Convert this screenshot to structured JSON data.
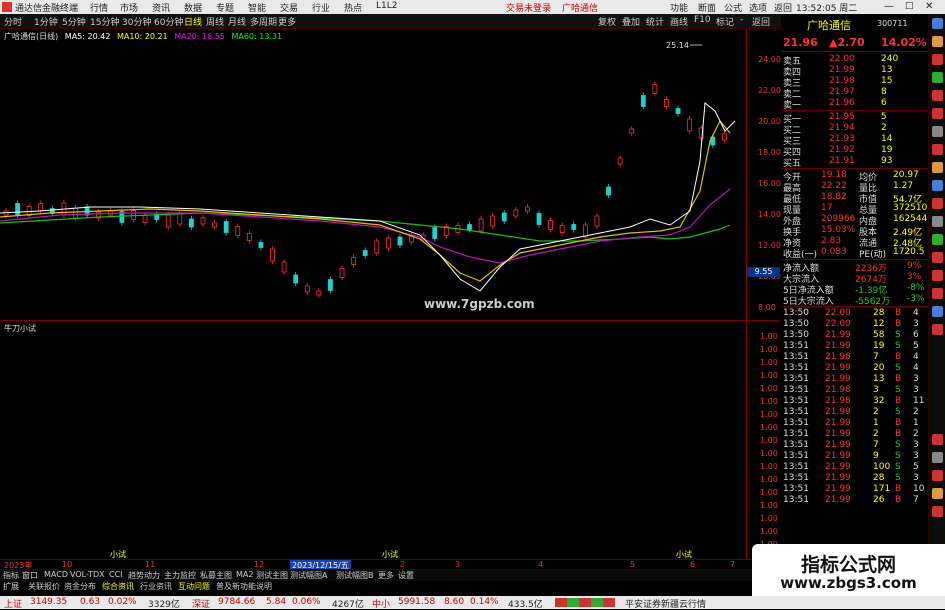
{
  "titlebar": {
    "app_title": "通达信金融终端",
    "menus": [
      "行情",
      "市场",
      "资讯",
      "数据",
      "专题",
      "智能",
      "交易",
      "行业",
      "热点",
      "L1L2"
    ],
    "center": [
      "交易未登录",
      "广哈通信"
    ],
    "right": [
      "功能",
      "断面",
      "公式",
      "选项",
      "返回"
    ],
    "clock": "13:52:05 周二"
  },
  "menubar": {
    "periods": [
      "分时",
      "1分钟",
      "5分钟",
      "15分钟",
      "30分钟",
      "60分钟",
      "日线",
      "周线",
      "月线",
      "多周期",
      "更多"
    ],
    "active": "日线",
    "right": [
      "复权",
      "叠加",
      "统计",
      "画线",
      "F10",
      "标记",
      "-",
      "返回"
    ]
  },
  "main_chart": {
    "legend_name": "广哈通信(日线)",
    "ma": [
      {
        "label": "MA5: 20.42",
        "color": "#ffffff"
      },
      {
        "label": "MA10: 20.21",
        "color": "#ffff00"
      },
      {
        "label": "MA20: 16.55",
        "color": "#ff00ff"
      },
      {
        "label": "MA60: 13.31",
        "color": "#00ff00"
      }
    ],
    "high_label": "25.14",
    "left_price": "9.55",
    "watermark": "www.7gpzb.com",
    "yticks": [
      "24.00",
      "22.00",
      "20.00",
      "18.00",
      "16.00",
      "14.00",
      "12.00",
      "10.00",
      "8.00"
    ]
  },
  "sub_chart": {
    "name": "牛刀小试",
    "yticks": [
      "1.00",
      "1.00",
      "1.00",
      "1.00",
      "1.00",
      "1.00",
      "1.00",
      "1.00",
      "1.00",
      "1.00",
      "1.00",
      "1.00",
      "1.00",
      "1.00",
      "1.00",
      "1.00",
      "1.00"
    ],
    "signals": [
      "小试",
      "小试",
      "小试"
    ]
  },
  "axis_bar": {
    "labels": [
      "2023年",
      "10",
      "11",
      "12",
      "2023/12/15/五",
      "2",
      "3",
      "4",
      "5",
      "6",
      "7"
    ]
  },
  "tabs": [
    "指标",
    "窗口",
    "MACD",
    "VOL-TDX",
    "CCI",
    "趋势动力",
    "主力监控",
    "私募主图",
    "MA2",
    "测试主图",
    "测试幅图A",
    "测试幅图B",
    "更多",
    "设置"
  ],
  "tabs2": [
    "扩展",
    "关联报价",
    "资金分布",
    "综合资讯",
    "行业资讯",
    "互动问题",
    "普及新功能说明"
  ],
  "quote": {
    "name": "广哈通信",
    "code": "300711",
    "price": "21.96",
    "change": "▲2.70",
    "pct": "14.02%",
    "asks": [
      {
        "label": "卖五",
        "price": "22.00",
        "vol": "240"
      },
      {
        "label": "卖四",
        "price": "21.99",
        "vol": "13"
      },
      {
        "label": "卖三",
        "price": "21.98",
        "vol": "15"
      },
      {
        "label": "卖二",
        "price": "21.97",
        "vol": "8"
      },
      {
        "label": "卖一",
        "price": "21.96",
        "vol": "6"
      }
    ],
    "bids": [
      {
        "label": "买一",
        "price": "21.95",
        "vol": "5"
      },
      {
        "label": "买二",
        "price": "21.94",
        "vol": "2"
      },
      {
        "label": "买三",
        "price": "21.93",
        "vol": "14"
      },
      {
        "label": "买四",
        "price": "21.92",
        "vol": "19"
      },
      {
        "label": "买五",
        "price": "21.91",
        "vol": "93"
      }
    ],
    "stats": [
      [
        "今开",
        "19.18",
        "均价",
        "20.97"
      ],
      [
        "最高",
        "22.22",
        "量比",
        "1.27"
      ],
      [
        "最低",
        "18.82",
        "市值",
        "54.7亿"
      ],
      [
        "现量",
        "17",
        "总量",
        "372510"
      ],
      [
        "外盘",
        "209966",
        "内盘",
        "162544"
      ],
      [
        "换手",
        "15.03%",
        "股本",
        "2.49亿"
      ],
      [
        "净资",
        "2.83",
        "流通",
        "2.48亿"
      ],
      [
        "收益(一)",
        "0.083",
        "PE(动)",
        "1720.5"
      ]
    ],
    "flows": [
      [
        "净流入额",
        "2236万",
        "9%"
      ],
      [
        "大宗流入",
        "2674万",
        "3%"
      ],
      [
        "5日净流入额",
        "-1.39亿",
        "-8%"
      ],
      [
        "5日大宗流入",
        "-5562万",
        "-3%"
      ]
    ],
    "ticks": [
      [
        "13:50",
        "22.00",
        "28",
        "B",
        "4"
      ],
      [
        "13:50",
        "22.00",
        "12",
        "B",
        "3"
      ],
      [
        "13:50",
        "21.99",
        "58",
        "S",
        "6"
      ],
      [
        "13:51",
        "21.99",
        "19",
        "S",
        "5"
      ],
      [
        "13:51",
        "21.98",
        "7",
        "B",
        "4"
      ],
      [
        "13:51",
        "21.99",
        "20",
        "S",
        "4"
      ],
      [
        "13:51",
        "21.99",
        "13",
        "B",
        "3"
      ],
      [
        "13:51",
        "21.98",
        "3",
        "S",
        "3"
      ],
      [
        "13:51",
        "21.98",
        "32",
        "B",
        "11"
      ],
      [
        "13:51",
        "21.99",
        "2",
        "S",
        "2"
      ],
      [
        "13:51",
        "21.99",
        "1",
        "B",
        "1"
      ],
      [
        "13:51",
        "21.99",
        "2",
        "B",
        "2"
      ],
      [
        "13:51",
        "21.99",
        "7",
        "S",
        "3"
      ],
      [
        "13:51",
        "21.99",
        "9",
        "S",
        "3"
      ],
      [
        "13:51",
        "21.99",
        "100",
        "S",
        "5"
      ],
      [
        "13:51",
        "21.99",
        "28",
        "S",
        "3"
      ],
      [
        "13:51",
        "21.99",
        "171",
        "B",
        "10"
      ],
      [
        "13:51",
        "21.99",
        "26",
        "B",
        "7"
      ]
    ]
  },
  "status": {
    "items": [
      {
        "label": "上证",
        "v1": "3149.35",
        "v2": "0.63",
        "v3": "0.02%",
        "v4": "3329亿"
      },
      {
        "label": "深证",
        "v1": "9784.66",
        "v2": "5.84",
        "v3": "0.06%",
        "v4": "4267亿"
      },
      {
        "label": "中小",
        "v1": "5991.58",
        "v2": "8.60",
        "v3": "0.14%",
        "v4": "433.5亿"
      }
    ],
    "right": "平安证券新疆云行情"
  },
  "badge": {
    "line1": "指标公式网",
    "line2": "www.zbgs3.com"
  }
}
